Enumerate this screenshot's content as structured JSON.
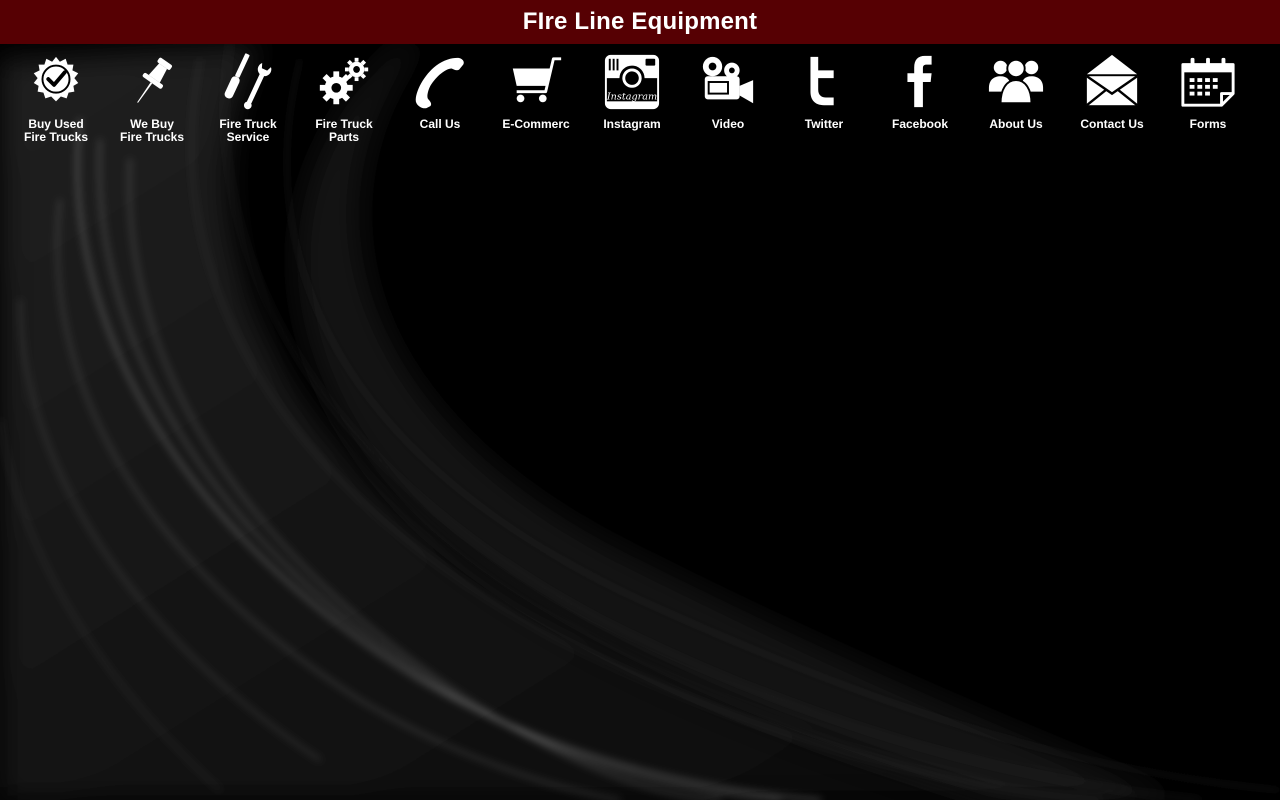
{
  "header": {
    "title": "FIre Line Equipment"
  },
  "nav": {
    "items": [
      {
        "label": "Buy Used\nFire Trucks",
        "icon": "badge-check-icon"
      },
      {
        "label": "We Buy\nFire Trucks",
        "icon": "pushpin-icon"
      },
      {
        "label": "Fire Truck\nService",
        "icon": "tools-icon"
      },
      {
        "label": "Fire Truck\nParts",
        "icon": "gears-icon"
      },
      {
        "label": "Call Us",
        "icon": "phone-icon"
      },
      {
        "label": "E-Commerc",
        "icon": "cart-icon"
      },
      {
        "label": "Instagram",
        "icon": "instagram-icon"
      },
      {
        "label": "Video",
        "icon": "video-camera-icon"
      },
      {
        "label": "Twitter",
        "icon": "twitter-icon"
      },
      {
        "label": "Facebook",
        "icon": "facebook-icon"
      },
      {
        "label": "About Us",
        "icon": "people-icon"
      },
      {
        "label": "Contact Us",
        "icon": "envelope-icon"
      },
      {
        "label": "Forms",
        "icon": "calendar-icon"
      }
    ]
  },
  "colors": {
    "header_bg": "#560003",
    "page_bg": "#000000",
    "icon": "#ffffff",
    "text": "#ffffff"
  }
}
